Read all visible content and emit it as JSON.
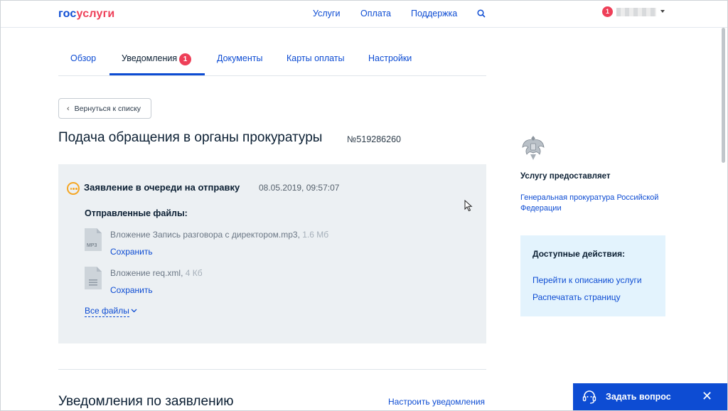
{
  "header": {
    "logo_part1": "гос",
    "logo_part2": "услуги",
    "nav": [
      "Услуги",
      "Оплата",
      "Поддержка"
    ],
    "search_icon": "search-icon",
    "notifications_count": "1"
  },
  "tabs": {
    "items": [
      "Обзор",
      "Уведомления",
      "Документы",
      "Карты оплаты",
      "Настройки"
    ],
    "active": "Уведомления",
    "badge": "1"
  },
  "back_button": "Вернуться к списку",
  "page": {
    "title": "Подача обращения в органы прокуратуры",
    "number": "№519286260"
  },
  "status": {
    "text": "Заявление в очереди на отправку",
    "date": "08.05.2019, 09:57:07",
    "icon": "pending-icon",
    "color": "#f5a623"
  },
  "files": {
    "heading": "Отправленные файлы:",
    "items": [
      {
        "name": "Вложение Запись разговора с директором.mp3",
        "size": "1.6 Мб",
        "ext": "MP3",
        "save": "Сохранить"
      },
      {
        "name": "Вложение req.xml",
        "size": "4 Кб",
        "ext": "",
        "save": "Сохранить"
      }
    ],
    "all_files": "Все файлы"
  },
  "sidebar": {
    "provider_label": "Услугу предоставляет",
    "provider_name": "Генеральная прокуратура Российской Федерации",
    "actions_heading": "Доступные действия:",
    "actions": [
      "Перейти к описанию услуги",
      "Распечатать страницу"
    ]
  },
  "section": {
    "title": "Уведомления по заявлению",
    "link": "Настроить уведомления"
  },
  "ask": {
    "label": "Задать вопрос"
  },
  "colors": {
    "brand_blue": "#0d4cd3",
    "brand_red": "#ee3f58",
    "card_bg": "#ecf0f3",
    "actions_bg": "#e3f3fd"
  }
}
